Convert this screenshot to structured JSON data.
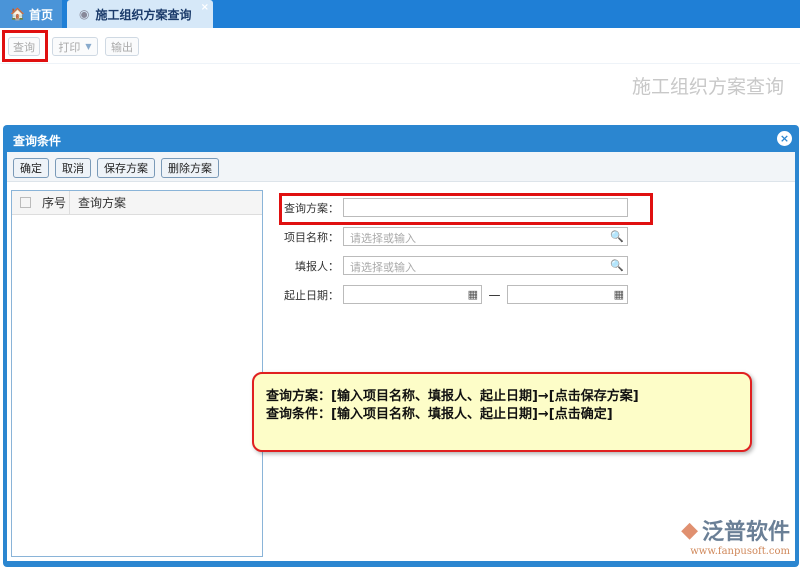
{
  "tabs": [
    {
      "label": "首页"
    },
    {
      "label": "施工组织方案查询",
      "close": "×"
    }
  ],
  "toolbar": {
    "query": "查询",
    "print": "打印",
    "export": "输出"
  },
  "page_title": "施工组织方案查询",
  "dialog": {
    "title": "查询条件",
    "close": "×",
    "buttons": {
      "confirm": "确定",
      "cancel": "取消",
      "save": "保存方案",
      "delete": "删除方案"
    },
    "list": {
      "headers": [
        "序号",
        "查询方案"
      ]
    },
    "form": {
      "scheme_label": "查询方案：",
      "scheme_value": "",
      "project_label": "项目名称：",
      "project_placeholder": "请选择或输入",
      "reporter_label": "填报人：",
      "reporter_placeholder": "请选择或输入",
      "date_label": "起止日期：",
      "date_sep": "—"
    }
  },
  "callout": {
    "line1": "查询方案：[输入项目名称、填报人、起止日期]→[点击保存方案]",
    "line2": "查询条件：[输入项目名称、填报人、起止日期]→[点击确定]"
  },
  "logo": {
    "name": "泛普软件",
    "url": "www.fanpusoft.com"
  }
}
